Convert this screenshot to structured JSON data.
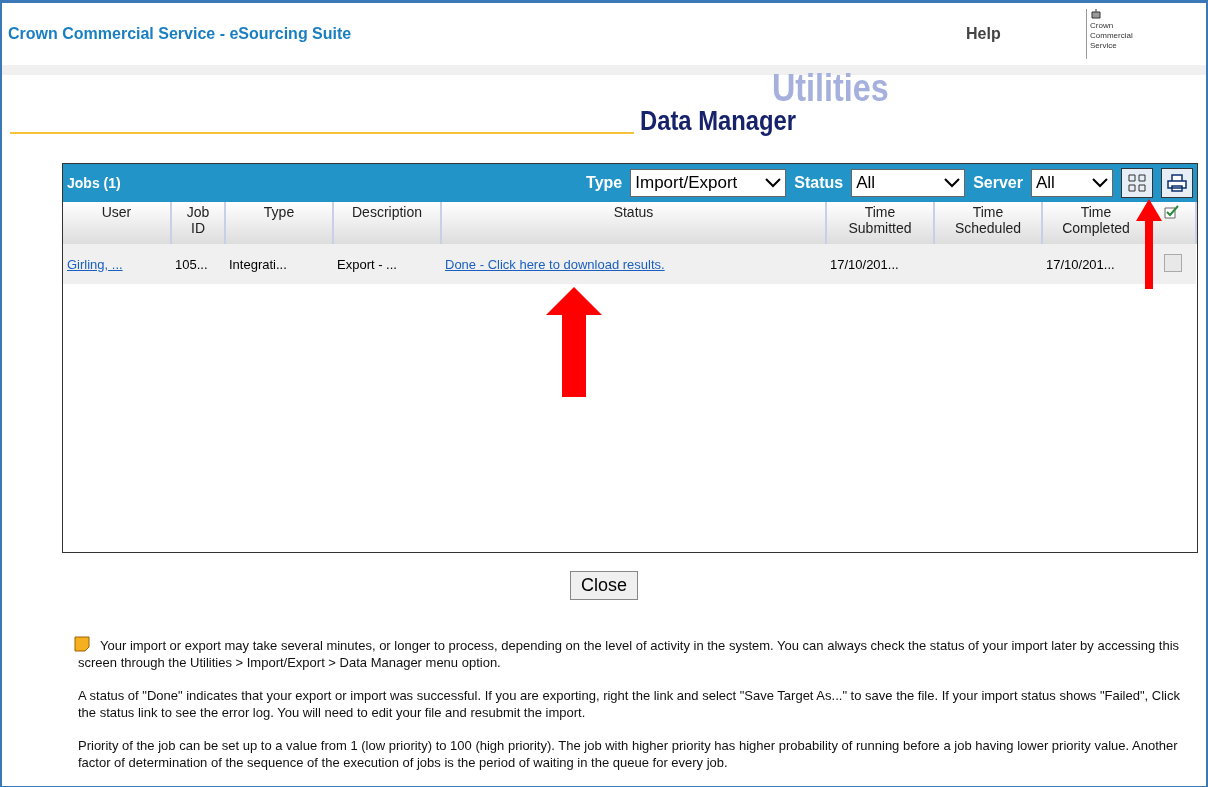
{
  "header": {
    "title": "Crown Commercial Service - eSourcing Suite",
    "help": "Help",
    "logo_lines": [
      "Crown",
      "Commercial",
      "Service"
    ]
  },
  "page": {
    "section": "Utilities",
    "title": "Data Manager"
  },
  "jobs": {
    "title": "Jobs (1)",
    "filters": [
      {
        "label": "Type",
        "value": "Import/Export"
      },
      {
        "label": "Status",
        "value": "All"
      },
      {
        "label": "Server",
        "value": "All"
      }
    ],
    "columns": [
      "User",
      "Job ID",
      "Type",
      "Description",
      "Status",
      "Time Submitted",
      "Time Scheduled",
      "Time Completed"
    ],
    "rows": [
      {
        "cells": [
          "Girling, ...",
          "105...",
          "Integrati...",
          "Export - ...",
          "Done - Click here to download results.",
          "17/10/201...",
          "",
          "17/10/201..."
        ],
        "checked": false
      }
    ]
  },
  "close": "Close",
  "notes": [
    "Your import or export may take several minutes, or longer to process, depending on the level of activity in the system. You can always check the status of your import later by accessing this screen through the Utilities > Import/Export > Data Manager menu option.",
    "A status of \"Done\" indicates that your export or import was successful. If you are exporting, right the link and select \"Save Target As...\" to save the file. If your import status shows \"Failed\", Click the status link to see the error log. You will need to edit your file and resubmit the import.",
    "Priority of the job can be set up to a value from 1 (low priority) to 100 (high priority). The job with higher priority has higher probability of running before a job having lower priority value. Another factor of determination of the sequence of the execution of jobs is the period of waiting in the queue for every job."
  ]
}
